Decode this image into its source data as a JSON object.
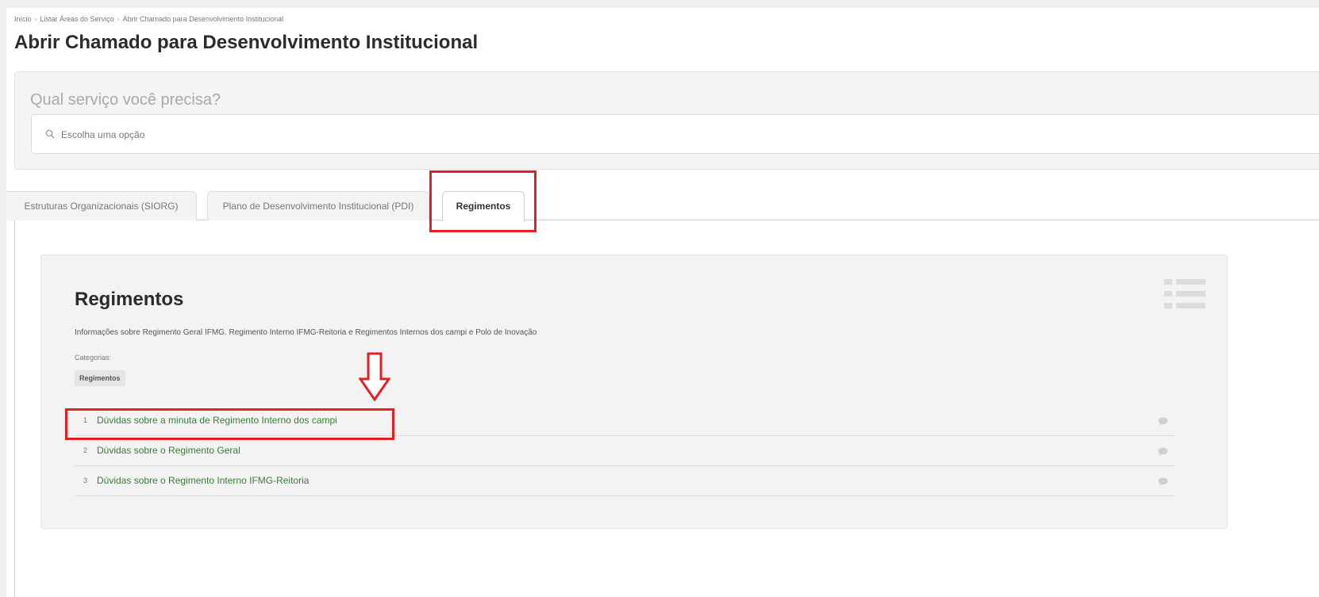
{
  "breadcrumb": {
    "items": [
      "Início",
      "Listar Áreas do Serviço",
      "Abrir Chamado para Desenvolvimento Institucional"
    ],
    "separator": "›"
  },
  "page": {
    "title": "Abrir Chamado para Desenvolvimento Institucional"
  },
  "search": {
    "question": "Qual serviço você precisa?",
    "placeholder": "Escolha uma opção"
  },
  "tabs": [
    {
      "label": "Estruturas Organizacionais (SIORG)",
      "active": false
    },
    {
      "label": "Plano de Desenvolvimento Institucional (PDI)",
      "active": false
    },
    {
      "label": "Regimentos",
      "active": true
    }
  ],
  "card": {
    "title": "Regimentos",
    "description": "Informações sobre Regimento Geral IFMG. Regimento Interno IFMG-Reitoria e Regimentos Internos dos campi e Polo de Inovação",
    "categories_label": "Categorias:",
    "category": "Regimentos",
    "services": [
      {
        "num": "1",
        "label": "Dúvidas sobre a minuta de Regimento Interno dos campi"
      },
      {
        "num": "2",
        "label": "Dúvidas sobre o Regimento Geral"
      },
      {
        "num": "3",
        "label": "Dúvidas sobre o Regimento Interno IFMG-Reitoria"
      }
    ]
  },
  "colors": {
    "accent_green": "#3c7a3c",
    "highlight_red": "#e41f26"
  },
  "icons": [
    "search-icon",
    "list-icon",
    "comment-icon",
    "down-arrow-icon"
  ]
}
